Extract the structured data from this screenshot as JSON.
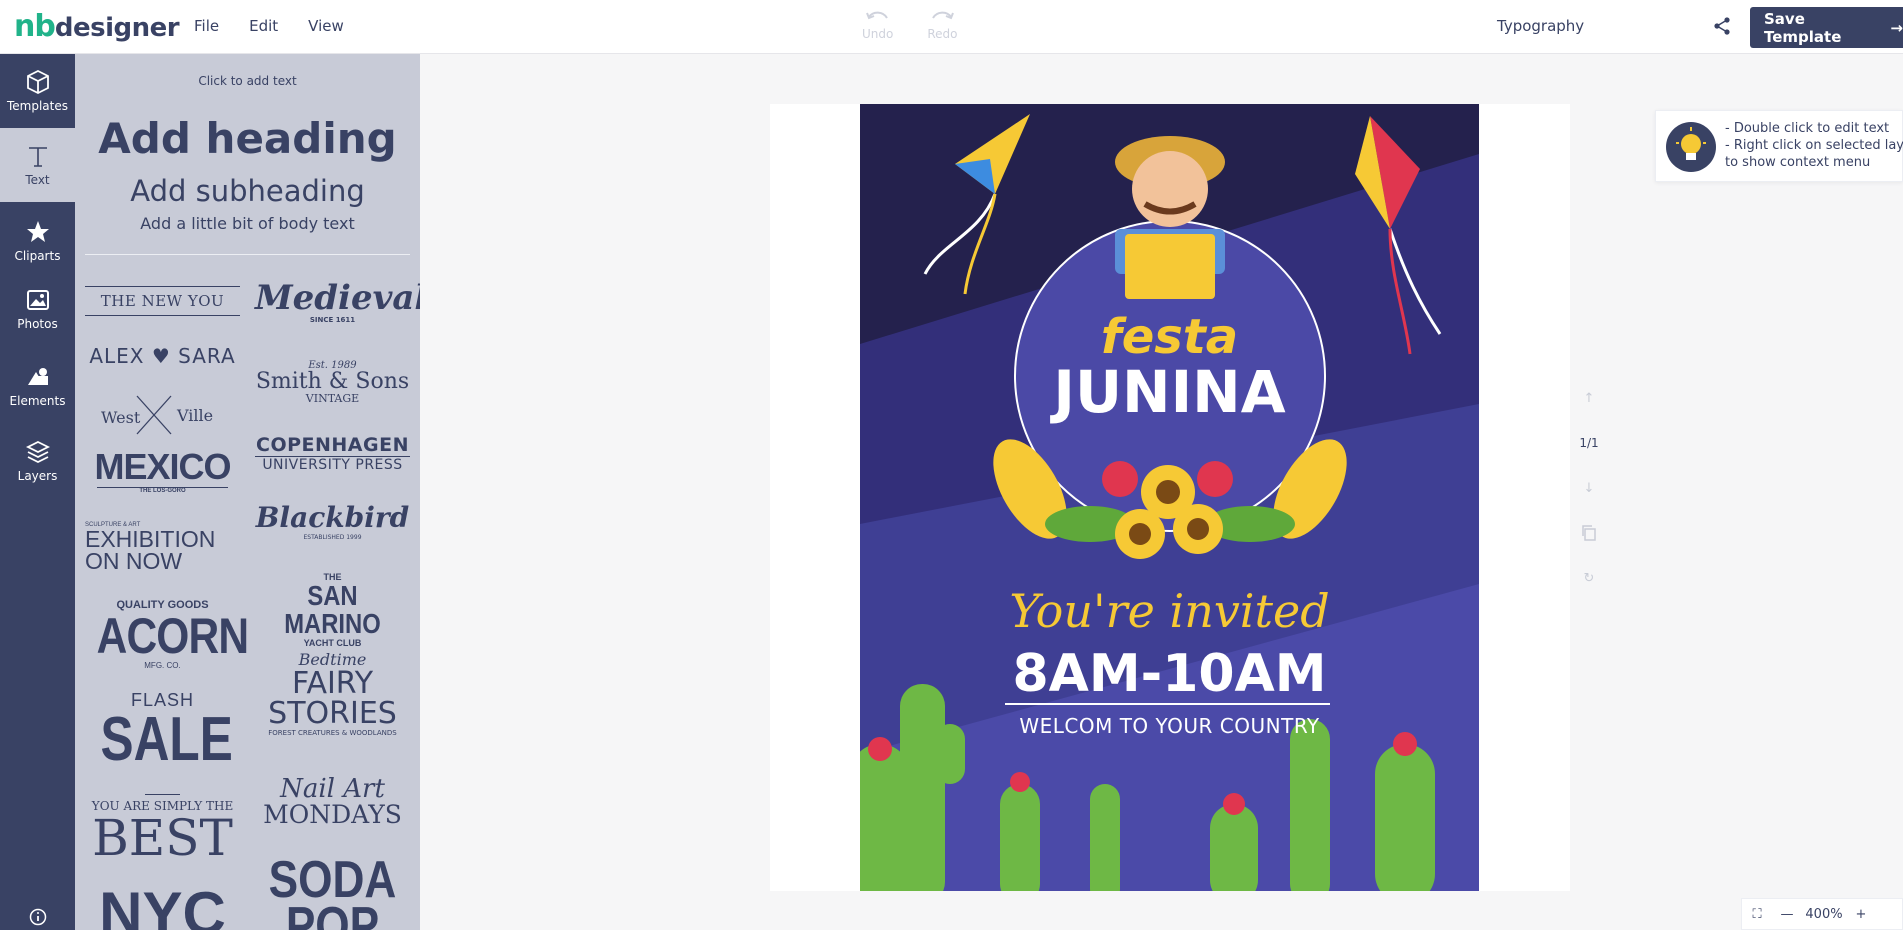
{
  "header": {
    "logo_nb": "nb",
    "logo_designer": "designer",
    "menu": [
      "File",
      "Edit",
      "View"
    ],
    "undo_label": "Undo",
    "redo_label": "Redo",
    "panel_title": "Typography",
    "save_label": "Save Template"
  },
  "rail": {
    "items": [
      "Templates",
      "Text",
      "Cliparts",
      "Photos",
      "Elements",
      "Layers"
    ]
  },
  "text_panel": {
    "click_to_add": "Click to add text",
    "heading": "Add heading",
    "subheading": "Add subheading",
    "body": "Add a little bit of body text"
  },
  "typography_templates": {
    "new_you": "THE NEW YOU",
    "medieval": "Medieval",
    "medieval_since": "SINCE 1611",
    "alex": "ALEX",
    "sara": "SARA",
    "est": "Est. 1989",
    "smith": "Smith & Sons",
    "vintage": "VINTAGE",
    "west": "West",
    "ville": "Ville",
    "copenhagen": "COPENHAGEN",
    "university": "UNIVERSITY PRESS",
    "mexico": "MEXICO",
    "mexico_sub": "THE LOS-GORO",
    "blackbird": "Blackbird",
    "blackbird_sub": "ESTABLISHED 1999",
    "exhibition_small": "SCULPTURE & ART",
    "exhibition": "EXHIBITION",
    "on_now": "ON NOW",
    "the": "THE",
    "san_marino": "SAN MARINO",
    "yacht": "YACHT CLUB",
    "quality": "QUALITY GOODS",
    "acorn": "ACORN",
    "mfg": "MFG. CO.",
    "bedtime": "Bedtime",
    "fairy": "FAIRY",
    "stories": "STORIES",
    "forest": "FOREST CREATURES & WOODLANDS",
    "flash": "FLASH",
    "sale": "SALE",
    "simply": "YOU ARE SIMPLY THE",
    "best": "BEST",
    "nail_art": "Nail Art",
    "mondays": "MONDAYS",
    "soda": "SODA",
    "pop": "POP",
    "nyc": "NYC"
  },
  "poster": {
    "festa": "festa",
    "junina": "JUNINA",
    "invited": "You're invited",
    "time": "8AM-10AM",
    "welcome": "WELCOM TO YOUR COUNTRY"
  },
  "page_nav": {
    "page_indicator": "1/1"
  },
  "tip": {
    "line1": "- Double click to edit text",
    "line2": "- Right click on selected layers",
    "line3": "to show context menu"
  },
  "zoom": {
    "level": "400%"
  },
  "colors": {
    "brand_green": "#21b38a",
    "navy": "#394264",
    "panel_bg": "#c8cbd7",
    "poster_bg": "#3f3f94",
    "poster_yellow": "#f6c935",
    "cactus_green": "#6eb845"
  }
}
